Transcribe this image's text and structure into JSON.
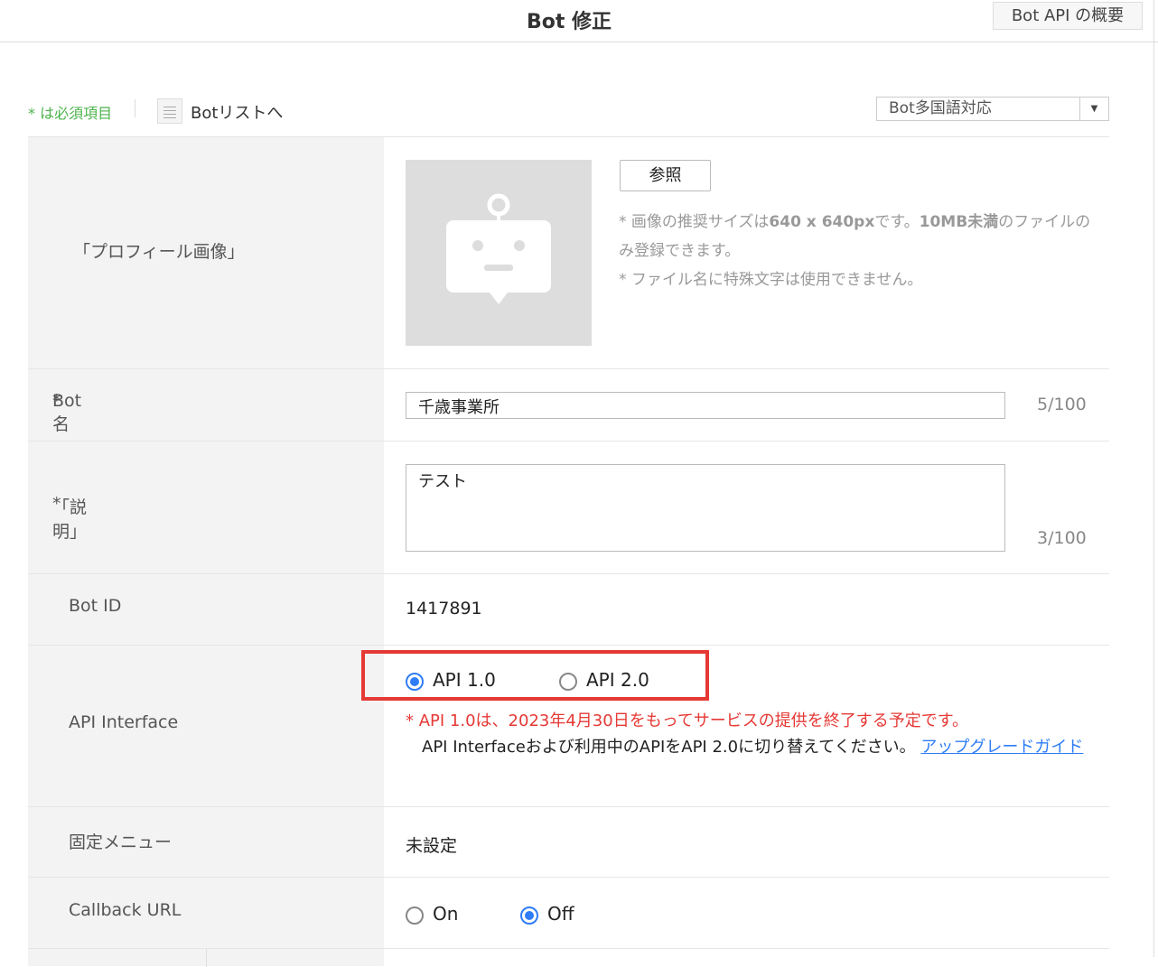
{
  "header": {
    "title": "Bot 修正",
    "overview_button": "Bot API の概要"
  },
  "toolbar": {
    "required_note": "* は必須項目",
    "list_link": "Botリストへ",
    "language_select": "Bot多国語対応"
  },
  "form": {
    "profile": {
      "label": "「プロフィール画像」",
      "browse_button": "参照",
      "note_prefix": "* 画像の推奨サイズは",
      "note_size": "640 x 640px",
      "note_mid": "です。",
      "note_limit": "10MB未満",
      "note_suffix": "のファイルのみ登録できます。",
      "note2": "* ファイル名に特殊文字は使用できません。"
    },
    "bot_name": {
      "required": "*",
      "label": "Bot名",
      "value": "千歳事業所",
      "count": "5/100"
    },
    "description": {
      "required": "*",
      "label": "「説明」",
      "value": "テスト",
      "count": "3/100"
    },
    "bot_id": {
      "label": "Bot ID",
      "value": "1417891"
    },
    "api_interface": {
      "label": "API Interface",
      "options": [
        {
          "label": "API 1.0",
          "selected": true
        },
        {
          "label": "API 2.0",
          "selected": false
        }
      ],
      "warning": "* API 1.0は、2023年4月30日をもってサービスの提供を終了する予定です。",
      "instruction": "API Interfaceおよび利用中のAPIをAPI 2.0に切り替えてください。",
      "guide_link": "アップグレードガイド",
      "highlight_color": "#e53935"
    },
    "fixed_menu": {
      "label": "固定メニュー",
      "value": "未設定"
    },
    "callback_url": {
      "label": "Callback URL",
      "options": [
        {
          "label": "On",
          "selected": false
        },
        {
          "label": "Off",
          "selected": true
        }
      ]
    }
  },
  "colors": {
    "accent": "#2f7df6",
    "required": "#4cb34c",
    "warning": "#e53935",
    "link": "#2f7df6"
  }
}
